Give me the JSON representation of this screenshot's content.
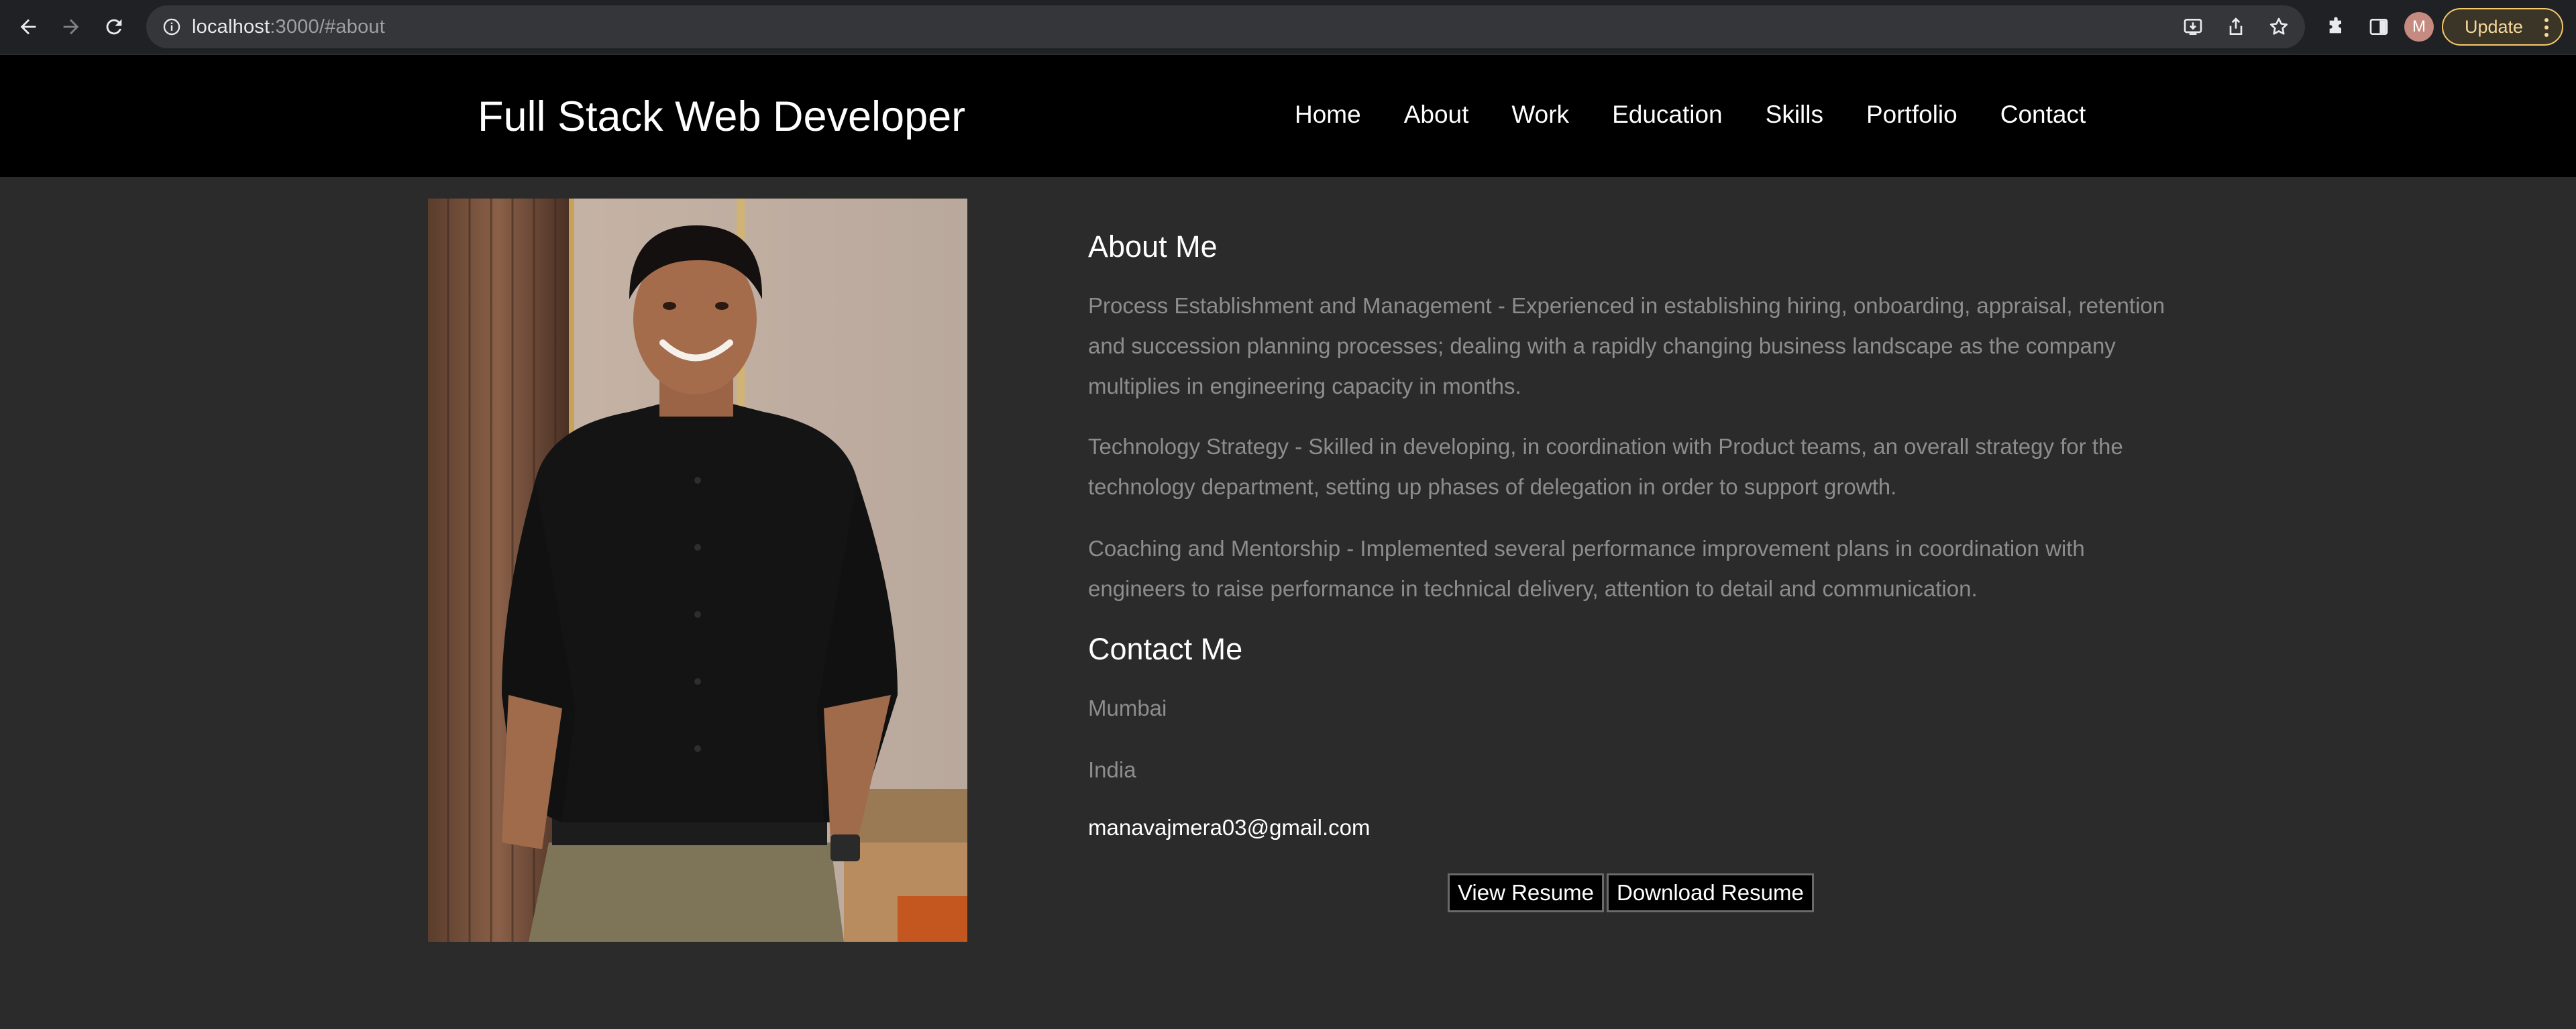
{
  "browser": {
    "url_host": "localhost",
    "url_rest": ":3000/#about",
    "avatar_letter": "M",
    "update_label": "Update"
  },
  "header": {
    "title": "Full Stack Web Developer",
    "nav": [
      "Home",
      "About",
      "Work",
      "Education",
      "Skills",
      "Portfolio",
      "Contact"
    ]
  },
  "about": {
    "heading": "About Me",
    "paragraphs": [
      "Process Establishment and Management - Experienced in establishing hiring, onboarding, appraisal, retention and succession planning processes; dealing with a rapidly changing business landscape as the company multiplies in engineering capacity in months.",
      "Technology Strategy - Skilled in developing, in coordination with Product teams, an overall strategy for the technology department, setting up phases of delegation in order to support growth.",
      "Coaching and Mentorship - Implemented several performance improvement plans in coordination with engineers to raise performance in technical delivery, attention to detail and communication."
    ]
  },
  "contact": {
    "heading": "Contact Me",
    "city": "Mumbai",
    "country": "India",
    "email": "manavajmera03@gmail.com"
  },
  "buttons": {
    "view_resume": "View Resume",
    "download_resume": "Download Resume"
  },
  "colors": {
    "page_bg": "#2b2b2b",
    "header_bg": "#000000",
    "body_text": "#8d8d8d",
    "update_accent": "#f7c96d"
  }
}
